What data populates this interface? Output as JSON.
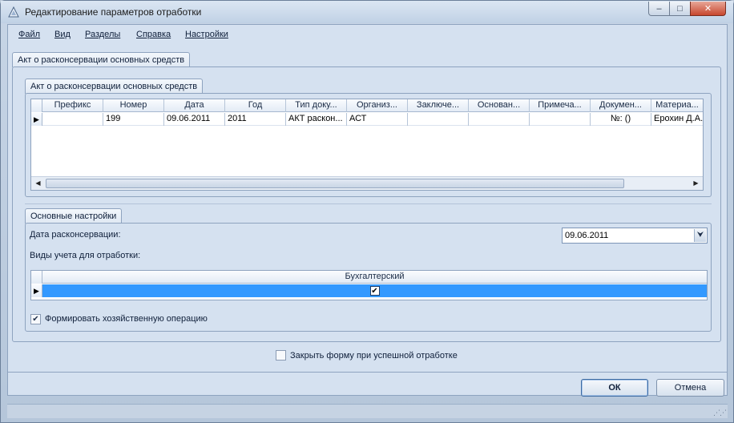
{
  "window": {
    "title": "Редактирование параметров отработки",
    "controls": {
      "minimize": "–",
      "maximize": "□",
      "close": "✕"
    }
  },
  "menu": [
    "Файл",
    "Вид",
    "Разделы",
    "Справка",
    "Настройки"
  ],
  "outer_tab": {
    "label": "Акт о расконсервации основных средств"
  },
  "doc_group": {
    "tab_label": "Акт о расконсервации основных средств",
    "columns": [
      "Префикс",
      "Номер",
      "Дата",
      "Год",
      "Тип доку...",
      "Организ...",
      "Заключе...",
      "Основан...",
      "Примеча...",
      "Докумен...",
      "Материа..."
    ],
    "rows": [
      [
        "",
        "199",
        "09.06.2011",
        "2011",
        "АКТ раскон...",
        "АСТ",
        "",
        "",
        "",
        "№: ()",
        "Ерохин Д.А."
      ]
    ],
    "row_marker": "▶"
  },
  "settings_group": {
    "tab_label": "Основные настройки",
    "date_label": "Дата расконсервации:",
    "date_value": "09.06.2011",
    "kinds_label": "Виды учета для отработки:",
    "kinds_table": {
      "column": "Бухгалтерский",
      "checked": true,
      "check_glyph": "✔"
    },
    "form_operation_label": "Формировать хозяйственную операцию",
    "form_operation_checked": true
  },
  "close_on_success_label": "Закрыть форму при успешной отработке",
  "close_on_success_checked": false,
  "buttons": {
    "ok": "ОК",
    "cancel": "Отмена"
  },
  "colors": {
    "selection": "#3399ff",
    "chrome": "#d5e1f0"
  }
}
